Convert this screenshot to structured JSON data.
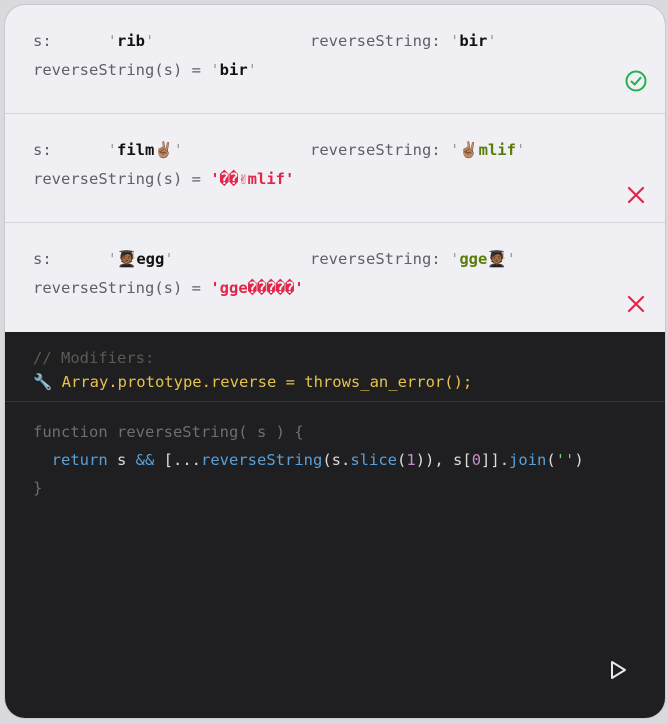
{
  "tests": [
    {
      "s_label": "s:",
      "s_quote_open": "'",
      "s_value": "rib",
      "s_quote_close": "'",
      "expected_label": "reverseString:",
      "expected_value": "bir",
      "result_prefix": "reverseString(s) = ",
      "result_value": "bir",
      "status": "pass",
      "status_icon": "check-circle-icon"
    },
    {
      "s_label": "s:",
      "s_quote_open": "'",
      "s_value": "film✌🏽",
      "s_quote_close": "'",
      "expected_label": "reverseString:",
      "expected_value": "✌🏽mlif",
      "result_prefix": "reverseString(s) = ",
      "result_value": "��✌mlif",
      "status": "fail",
      "status_icon": "x-icon"
    },
    {
      "s_label": "s:",
      "s_quote_open": "'",
      "s_value": "🧑🏾‍🎓egg",
      "s_quote_close": "'",
      "expected_label": "reverseString:",
      "expected_value": "gge🧑🏾‍🎓",
      "result_prefix": "reverseString(s) = ",
      "result_value": "gge���‍��",
      "status": "fail",
      "status_icon": "x-icon"
    }
  ],
  "modifiers": {
    "comment": "// Modifiers:",
    "icon": "wrench-icon",
    "icon_glyph": "🔧",
    "line": " Array.prototype.reverse = throws_an_error();"
  },
  "code": {
    "line1": "function reverseString( s ) {",
    "line2_kw": "return",
    "line2_a": " s ",
    "line2_op": "&&",
    "line2_b": " [...",
    "line2_fn": "reverseString",
    "line2_c": "(s.",
    "line2_slice": "slice",
    "line2_d": "(",
    "line2_one": "1",
    "line2_e": ")), s[",
    "line2_zero": "0",
    "line2_f": "]].",
    "line2_join": "join",
    "line2_g": "(",
    "line2_str": "''",
    "line2_h": ")",
    "line3": "}"
  },
  "run_icon": "play-icon",
  "colors": {
    "pass": "#22b14c",
    "fail": "#e1264a",
    "expected": "#5a7d0a",
    "modifier": "#e6c34a"
  }
}
